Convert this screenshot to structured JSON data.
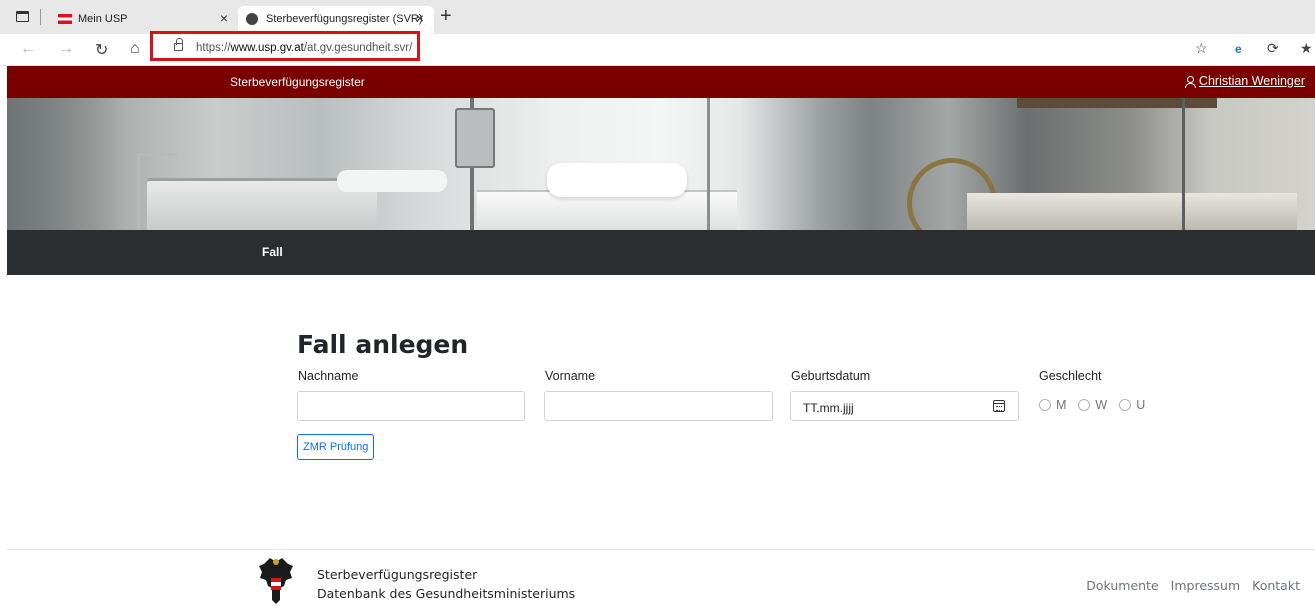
{
  "browser": {
    "tabs": [
      {
        "label": "Mein USP",
        "active": false
      },
      {
        "label": "Sterbeverfügungsregister (SVR)",
        "active": true
      }
    ],
    "close_glyph": "×",
    "new_tab_glyph": "+",
    "url_prefix": "https://",
    "url_host": "www.usp.gv.at",
    "url_path": "/at.gv.gesundheit.svr/",
    "highlight_color": "#d3151b"
  },
  "header": {
    "title": "Sterbeverfügungsregister",
    "user_name": "Christian Weninger",
    "color": "#7a0000"
  },
  "nav": {
    "items": [
      {
        "label": "Fall"
      }
    ]
  },
  "form": {
    "title": "Fall anlegen",
    "nachname_label": "Nachname",
    "nachname_value": "",
    "vorname_label": "Vorname",
    "vorname_value": "",
    "geburtsdatum_label": "Geburtsdatum",
    "geburtsdatum_placeholder": "TT.mm.jjjj",
    "geschlecht_label": "Geschlecht",
    "geschlecht_options": [
      "M",
      "W",
      "U"
    ],
    "zmr_button": "ZMR Prüfung"
  },
  "footer": {
    "line1": "Sterbeverfügungsregister",
    "line2": "Datenbank des Gesundheitsministeriums",
    "links": [
      "Dokumente",
      "Impressum",
      "Kontakt"
    ]
  },
  "icons": {
    "window": "window-icon",
    "lock": "lock-icon",
    "calendar": "calendar-icon",
    "user": "user-icon",
    "coat_of_arms": "austrian-eagle-icon"
  }
}
